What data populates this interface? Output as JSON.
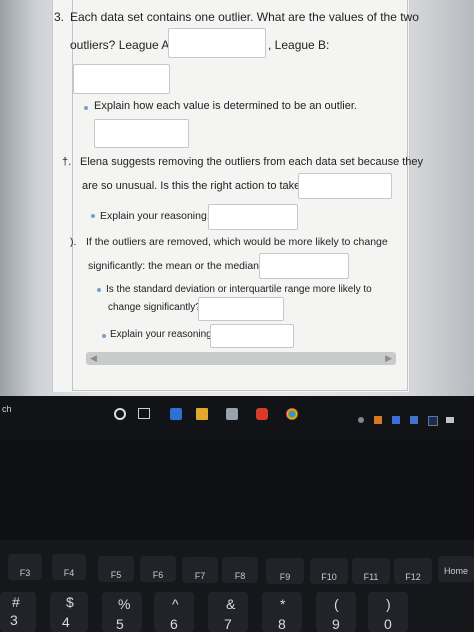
{
  "questions": {
    "q3_number": "3.",
    "q3_line1": "Each data set contains one outlier. What are the values of the two",
    "q3_line2_a": "outliers? League A:",
    "q3_line2_b": ", League B:",
    "q3_bullet": "Explain how each value is determined to be an outlier.",
    "q4_number": "†.",
    "q4_line1": "Elena suggests removing the outliers from each data set because they",
    "q4_line2": "are so unusual. Is this the right action to take?",
    "q4_bullet": "Explain your reasoning.",
    "q5_number": ").",
    "q5_line1": "If the outliers are removed, which would be more likely to change",
    "q5_line2": "significantly: the mean or the median?",
    "q5_bullet1_line1": "Is the standard deviation or interquartile range more likely to",
    "q5_bullet1_line2": "change significantly?",
    "q5_bullet2": "Explain your reasoning."
  },
  "taskbar": {
    "search_fragment": "ch"
  },
  "keyboard": {
    "fkeys": [
      "F3",
      "F4",
      "F5",
      "F6",
      "F7",
      "F8",
      "F9",
      "F10",
      "F11",
      "F12",
      "Home"
    ],
    "numbers": [
      "#",
      "3",
      "$",
      "4",
      "%",
      "5",
      "^",
      "6",
      "&",
      "7",
      "*",
      "8",
      "(",
      "9",
      ")",
      "0"
    ]
  },
  "colors": {
    "accent_bullet": "#7aa0c7",
    "panel": "#f4f4f3"
  }
}
